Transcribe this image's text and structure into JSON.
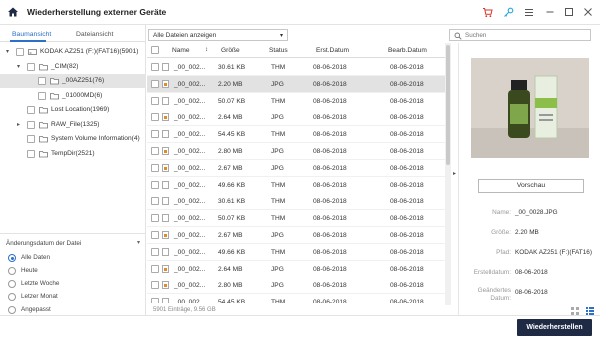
{
  "window": {
    "title": "Wiederherstellung externer Geräte"
  },
  "toolbar_icons": [
    "cart-icon",
    "key-icon",
    "menu-icon",
    "minimize-icon",
    "maximize-icon",
    "close-icon"
  ],
  "left": {
    "tabs": [
      {
        "label": "Baumansicht",
        "active": true
      },
      {
        "label": "Dateiansicht",
        "active": false
      }
    ],
    "tree": [
      {
        "label": "KODAK AZ251 (F:)(FAT16)(5901)",
        "level": 0,
        "arrow": "▾",
        "icon": "drive-icon",
        "selected": false
      },
      {
        "label": "_CIM(82)",
        "level": 1,
        "arrow": "▾",
        "icon": "folder-icon",
        "selected": false
      },
      {
        "label": "_00AZ251(76)",
        "level": 2,
        "arrow": "",
        "icon": "folder-icon",
        "selected": true
      },
      {
        "label": "_01000MD(6)",
        "level": 2,
        "arrow": "",
        "icon": "folder-icon",
        "selected": false
      },
      {
        "label": "Lost Location(1969)",
        "level": 1,
        "arrow": "",
        "icon": "folder-icon",
        "selected": false
      },
      {
        "label": "RAW_File(1325)",
        "level": 1,
        "arrow": "▸",
        "icon": "folder-icon",
        "selected": false
      },
      {
        "label": "System Volume Information(4)",
        "level": 1,
        "arrow": "",
        "icon": "folder-icon",
        "selected": false
      },
      {
        "label": "TempDir(2521)",
        "level": 1,
        "arrow": "",
        "icon": "folder-icon",
        "selected": false
      }
    ],
    "date_filter": {
      "header": "Änderungsdatum der Datei",
      "options": [
        {
          "label": "Alle Daten",
          "checked": true
        },
        {
          "label": "Heute",
          "checked": false
        },
        {
          "label": "Letzte Woche",
          "checked": false
        },
        {
          "label": "Letzer Monat",
          "checked": false
        },
        {
          "label": "Angepasst",
          "checked": false
        }
      ]
    }
  },
  "center": {
    "filter_value": "Alle Dateien anzeigen",
    "search_placeholder": "Suchen",
    "columns": [
      "Name",
      "Größe",
      "Status",
      "Erst.Datum",
      "Bearb.Datum"
    ],
    "rows": [
      {
        "name": "_00_002...",
        "size": "30.61 KB",
        "status": "THM",
        "created": "08-06-2018",
        "modified": "08-06-2018",
        "icon": "blank",
        "selected": false
      },
      {
        "name": "_00_002...",
        "size": "2.20 MB",
        "status": "JPG",
        "created": "08-06-2018",
        "modified": "08-06-2018",
        "icon": "image",
        "selected": true
      },
      {
        "name": "_00_002...",
        "size": "50.07 KB",
        "status": "THM",
        "created": "08-06-2018",
        "modified": "08-06-2018",
        "icon": "blank",
        "selected": false
      },
      {
        "name": "_00_002...",
        "size": "2.64 MB",
        "status": "JPG",
        "created": "08-06-2018",
        "modified": "08-06-2018",
        "icon": "image",
        "selected": false
      },
      {
        "name": "_00_002...",
        "size": "54.45 KB",
        "status": "THM",
        "created": "08-06-2018",
        "modified": "08-06-2018",
        "icon": "blank",
        "selected": false
      },
      {
        "name": "_00_002...",
        "size": "2.80 MB",
        "status": "JPG",
        "created": "08-06-2018",
        "modified": "08-06-2018",
        "icon": "image",
        "selected": false
      },
      {
        "name": "_00_002...",
        "size": "2.67 MB",
        "status": "JPG",
        "created": "08-06-2018",
        "modified": "08-06-2018",
        "icon": "image",
        "selected": false
      },
      {
        "name": "_00_002...",
        "size": "49.66 KB",
        "status": "THM",
        "created": "08-06-2018",
        "modified": "08-06-2018",
        "icon": "blank",
        "selected": false
      },
      {
        "name": "_00_002...",
        "size": "30.61 KB",
        "status": "THM",
        "created": "08-06-2018",
        "modified": "08-06-2018",
        "icon": "blank",
        "selected": false
      },
      {
        "name": "_00_002...",
        "size": "50.07 KB",
        "status": "THM",
        "created": "08-06-2018",
        "modified": "08-06-2018",
        "icon": "blank",
        "selected": false
      },
      {
        "name": "_00_002...",
        "size": "2.67 MB",
        "status": "JPG",
        "created": "08-06-2018",
        "modified": "08-06-2018",
        "icon": "image",
        "selected": false
      },
      {
        "name": "_00_002...",
        "size": "49.66 KB",
        "status": "THM",
        "created": "08-06-2018",
        "modified": "08-06-2018",
        "icon": "blank",
        "selected": false
      },
      {
        "name": "_00_002...",
        "size": "2.64 MB",
        "status": "JPG",
        "created": "08-06-2018",
        "modified": "08-06-2018",
        "icon": "image",
        "selected": false
      },
      {
        "name": "_00_002...",
        "size": "2.80 MB",
        "status": "JPG",
        "created": "08-06-2018",
        "modified": "08-06-2018",
        "icon": "image",
        "selected": false
      },
      {
        "name": "_00_002...",
        "size": "54.45 KB",
        "status": "THM",
        "created": "08-06-2018",
        "modified": "08-06-2018",
        "icon": "blank",
        "selected": false
      }
    ],
    "status_text": "5901 Einträge, 9.56 GB"
  },
  "preview": {
    "button_label": "Vorschau",
    "meta": [
      {
        "key": "Name:",
        "value": "_00_0028.JPG"
      },
      {
        "key": "Größe:",
        "value": "2.20 MB"
      },
      {
        "key": "Pfad:",
        "value": "KODAK AZ251 (F:)(FAT16)"
      },
      {
        "key": "Erstelldatum:",
        "value": "08-06-2018"
      },
      {
        "key": "Geändertes Datum:",
        "value": "08-06-2018"
      }
    ]
  },
  "actions": {
    "recover_label": "Wiederherstellen"
  },
  "colors": {
    "accent": "#2d70c7",
    "recover_bg": "#1f2a44",
    "selected_row": "#e2e2e2"
  }
}
